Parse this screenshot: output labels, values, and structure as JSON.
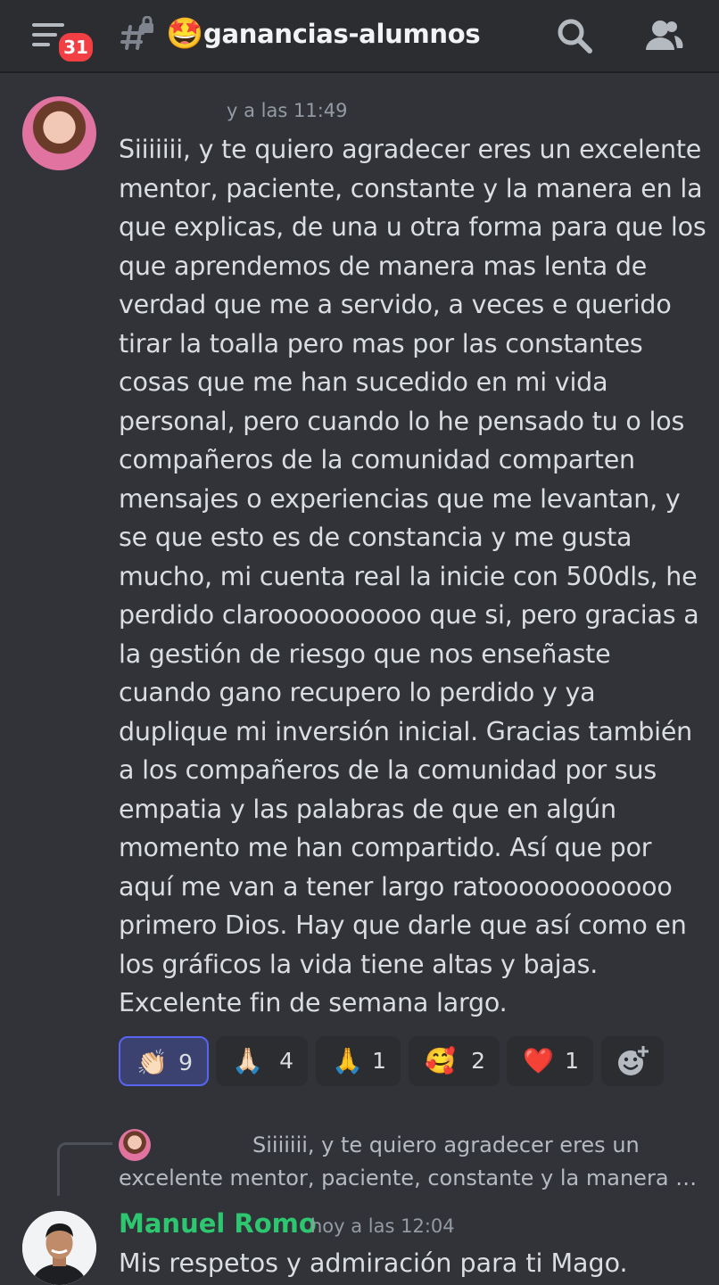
{
  "header": {
    "unread_badge": "31",
    "channel_emoji": "🤩",
    "channel_name": "ganancias-alumnos"
  },
  "message1": {
    "timestamp": "y a las 11:49",
    "text": "Siiiiiii, y te quiero agradecer eres un excelente mentor, paciente, constante y la manera en la que explicas, de una u otra forma para que los que aprendemos de manera mas lenta de verdad que me a servido, a veces e querido tirar la toalla pero mas por las constantes cosas que me han sucedido en mi vida personal, pero cuando lo he pensado tu o los compañeros de la comunidad comparten mensajes o experiencias que me levantan, y se que esto es de constancia y me gusta mucho, mi cuenta real la inicie con 500dls, he perdido claroooooooooo que si, pero gracias a la gestión de riesgo que nos enseñaste cuando gano recupero lo perdido y ya duplique mi inversión inicial. Gracias también a los compañeros de la comunidad por sus empatia y las palabras de que en algún momento me han compartido. Así que por aquí me van a tener largo ratoooooooooooo primero Dios. Hay que darle que así como en los gráficos la vida tiene altas y bajas. Excelente fin de semana largo."
  },
  "reactions": [
    {
      "emoji": "👏🏻",
      "count": "9",
      "active": true
    },
    {
      "emoji": "🙏🏻",
      "count": "4",
      "active": false
    },
    {
      "emoji": "🙏",
      "count": "1",
      "active": false
    },
    {
      "emoji": "🥰",
      "count": "2",
      "active": false
    },
    {
      "emoji": "❤️",
      "count": "1",
      "active": false
    }
  ],
  "reply_preview": {
    "text": "Siiiiiii, y te quiero agradecer eres un excelente mentor, paciente, constante y la manera …"
  },
  "message2": {
    "author": "Manuel Romo",
    "author_color": "#2dc770",
    "timestamp": "hoy a las 12:04",
    "text": "Mis respetos y admiración para ti Mago."
  }
}
